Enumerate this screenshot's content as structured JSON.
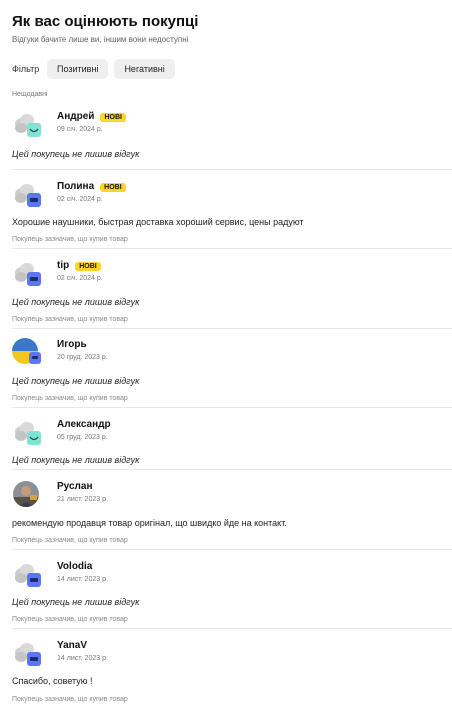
{
  "header": {
    "title": "Як вас оцінюють покупці",
    "subtitle": "Відгуки бачите лише ви, іншим вони недоступні"
  },
  "filter": {
    "label": "Фільтр",
    "positive": "Позитивні",
    "negative": "Негативні"
  },
  "sort_label": "Нещодавні",
  "colors": {
    "badge": "#fed42b",
    "avatar_mint": "#7fe3d4",
    "avatar_blue": "#5b76f5",
    "avatar_cloud": "#c8c8c8"
  },
  "reviews": [
    {
      "name": "Андрей",
      "badge": "НОВІ",
      "date": "09 січ. 2024 р.",
      "text": "Цей покупець не лишив відгук",
      "italic": true,
      "verified": "",
      "avatar": "mint-smile-icon"
    },
    {
      "name": "Полина",
      "badge": "НОВІ",
      "date": "02 січ. 2024 р.",
      "text": "Хорошие наушники, быстрая доставка хороший сервис, цены радуют",
      "italic": false,
      "verified": "Покупець зазначив, що купив товар",
      "avatar": "blue-face-icon"
    },
    {
      "name": "tip",
      "badge": "НОВІ",
      "date": "02 січ. 2024 р.",
      "text": "Цей покупець не лишив відгук",
      "italic": true,
      "verified": "Покупець зазначив, що купив товар",
      "avatar": "blue-face-icon"
    },
    {
      "name": "Игорь",
      "badge": "",
      "date": "20 груд. 2023 р.",
      "text": "Цей покупець не лишив відгук",
      "italic": true,
      "verified": "Покупець зазначив, що купив товар",
      "avatar": "flag-photo"
    },
    {
      "name": "Александр",
      "badge": "",
      "date": "05 груд. 2023 р.",
      "text": "Цей покупець не лишив відгук",
      "italic": true,
      "verified": "",
      "avatar": "mint-smile-icon"
    },
    {
      "name": "Руслан",
      "badge": "",
      "date": "21 лист. 2023 р.",
      "text": "рекомендую продавця товар оригінал, що швидко йде на контакт.",
      "italic": false,
      "verified": "Покупець зазначив, що купив товар",
      "avatar": "person-photo"
    },
    {
      "name": "Volodia",
      "badge": "",
      "date": "14 лист. 2023 р.",
      "text": "Цей покупець не лишив відгук",
      "italic": true,
      "verified": "Покупець зазначив, що купив товар",
      "avatar": "blue-face-icon"
    },
    {
      "name": "YanaV",
      "badge": "",
      "date": "14 лист. 2023 р.",
      "text": "Спасибо, советую !",
      "italic": false,
      "verified": "Покупець зазначив, що купив товар",
      "avatar": "blue-face-icon"
    }
  ]
}
